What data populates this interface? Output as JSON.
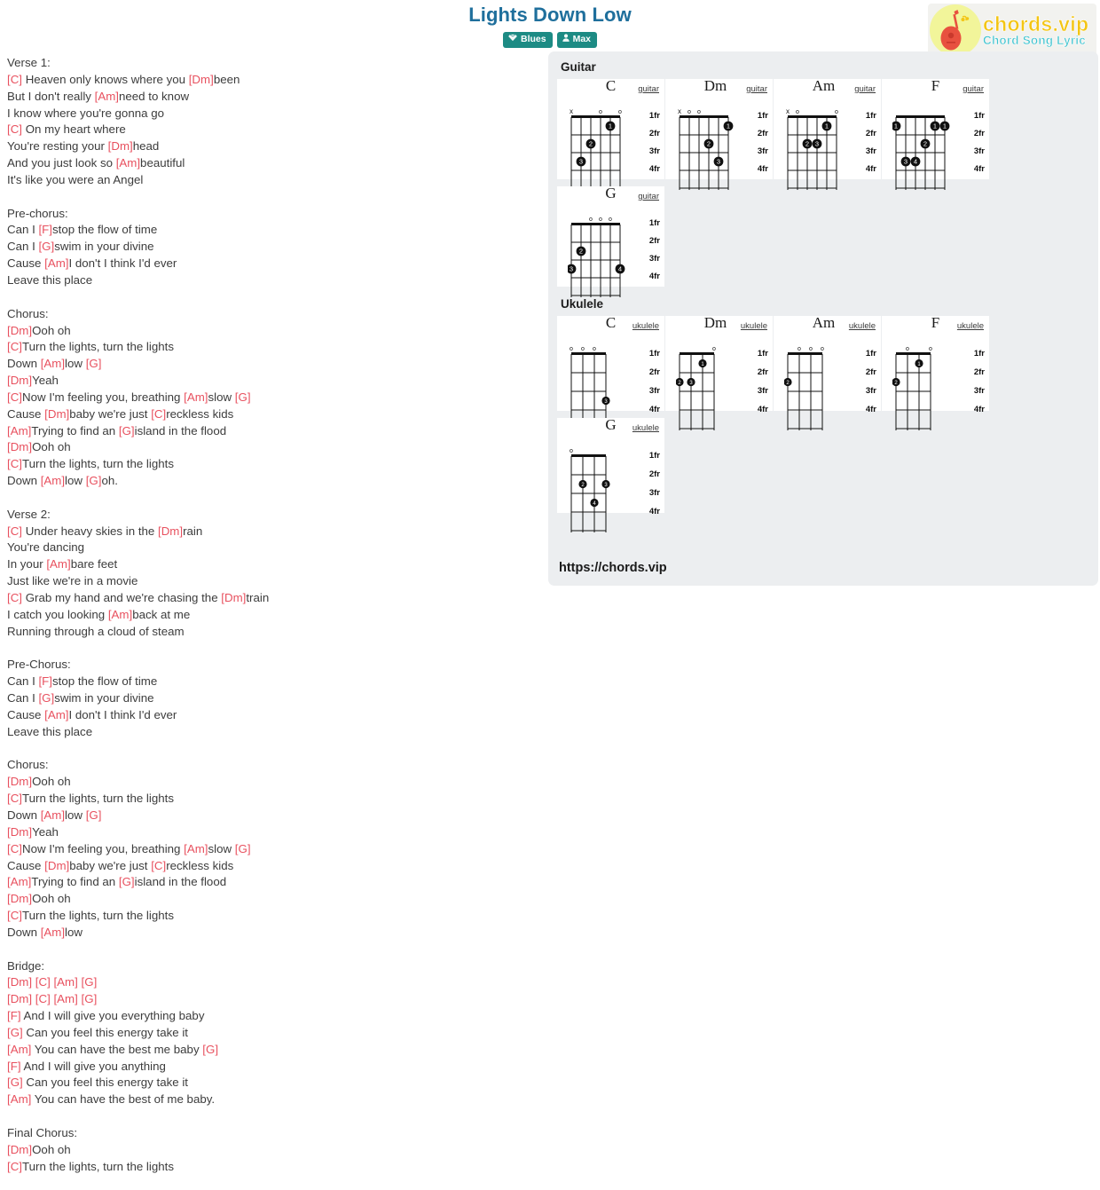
{
  "header": {
    "title": "Lights Down Low",
    "badges": [
      {
        "label": "Blues",
        "icon": "gem-icon",
        "glyph": "♦"
      },
      {
        "label": "Max",
        "icon": "user-icon",
        "glyph": "●"
      }
    ]
  },
  "logo": {
    "line1": "chords.vip",
    "line2": "Chord Song Lyric",
    "icon": "guitar-icon"
  },
  "lyrics": {
    "text": "Verse 1:\n[C] Heaven only knows where you [Dm]been\nBut I don't really [Am]need to know\nI know where you're gonna go\n[C] On my heart where\nYou're resting your [Dm]head\nAnd you just look so [Am]beautiful\nIt's like you were an Angel\n\nPre-chorus:\nCan I [F]stop the flow of time\nCan I [G]swim in your divine\nCause [Am]I don't I think I'd ever\nLeave this place\n\nChorus:\n[Dm]Ooh oh\n[C]Turn the lights, turn the lights\nDown [Am]low [G]\n[Dm]Yeah\n[C]Now I'm feeling you, breathing [Am]slow [G]\nCause [Dm]baby we're just [C]reckless kids\n[Am]Trying to find an [G]island in the flood\n[Dm]Ooh oh\n[C]Turn the lights, turn the lights\nDown [Am]low [G]oh.\n\nVerse 2:\n[C] Under heavy skies in the [Dm]rain\nYou're dancing\nIn your [Am]bare feet\nJust like we're in a movie\n[C] Grab my hand and we're chasing the [Dm]train\nI catch you looking [Am]back at me\nRunning through a cloud of steam\n\nPre-Chorus:\nCan I [F]stop the flow of time\nCan I [G]swim in your divine\nCause [Am]I don't I think I'd ever\nLeave this place\n\nChorus:\n[Dm]Ooh oh\n[C]Turn the lights, turn the lights\nDown [Am]low [G]\n[Dm]Yeah\n[C]Now I'm feeling you, breathing [Am]slow [G]\nCause [Dm]baby we're just [C]reckless kids\n[Am]Trying to find an [G]island in the flood\n[Dm]Ooh oh\n[C]Turn the lights, turn the lights\nDown [Am]low\n\nBridge:\n[Dm] [C] [Am] [G]\n[Dm] [C] [Am] [G]\n[F] And I will give you everything baby\n[G] Can you feel this energy take it\n[Am] You can have the best me baby [G]\n[F] And I will give you anything\n[G] Can you feel this energy take it\n[Am] You can have the best of me baby.\n\nFinal Chorus:\n[Dm]Ooh oh\n[C]Turn the lights, turn the lights"
  },
  "chords": {
    "guitar_section_title": "Guitar",
    "ukulele_section_title": "Ukulele",
    "fret_labels": [
      "1fr",
      "2fr",
      "3fr",
      "4fr"
    ],
    "instrument_label_guitar": "guitar",
    "instrument_label_ukulele": "ukulele",
    "guitar": [
      {
        "name": "C",
        "instrument": "guitar",
        "strings": 6,
        "open_marks": [
          "x",
          "",
          "",
          "o",
          "",
          "o"
        ],
        "dots": [
          {
            "string": 5,
            "fret": 1,
            "finger": "1"
          },
          {
            "string": 3,
            "fret": 2,
            "finger": "2"
          },
          {
            "string": 2,
            "fret": 3,
            "finger": "3"
          }
        ]
      },
      {
        "name": "Dm",
        "instrument": "guitar",
        "strings": 6,
        "open_marks": [
          "x",
          "o",
          "o",
          "",
          "",
          ""
        ],
        "dots": [
          {
            "string": 6,
            "fret": 1,
            "finger": "1"
          },
          {
            "string": 4,
            "fret": 2,
            "finger": "2"
          },
          {
            "string": 5,
            "fret": 3,
            "finger": "3"
          }
        ]
      },
      {
        "name": "Am",
        "instrument": "guitar",
        "strings": 6,
        "open_marks": [
          "x",
          "o",
          "",
          "",
          "",
          "o"
        ],
        "dots": [
          {
            "string": 5,
            "fret": 1,
            "finger": "1"
          },
          {
            "string": 3,
            "fret": 2,
            "finger": "2"
          },
          {
            "string": 4,
            "fret": 2,
            "finger": "3"
          }
        ]
      },
      {
        "name": "F",
        "instrument": "guitar",
        "strings": 6,
        "open_marks": [
          "",
          "",
          "",
          "",
          "",
          ""
        ],
        "dots": [
          {
            "string": 1,
            "fret": 1,
            "finger": "1"
          },
          {
            "string": 5,
            "fret": 1,
            "finger": "1"
          },
          {
            "string": 6,
            "fret": 1,
            "finger": "1"
          },
          {
            "string": 4,
            "fret": 2,
            "finger": "2"
          },
          {
            "string": 2,
            "fret": 3,
            "finger": "3"
          },
          {
            "string": 3,
            "fret": 3,
            "finger": "4"
          }
        ]
      },
      {
        "name": "G",
        "instrument": "guitar",
        "strings": 6,
        "open_marks": [
          "",
          "",
          "o",
          "o",
          "o",
          ""
        ],
        "dots": [
          {
            "string": 2,
            "fret": 2,
            "finger": "2"
          },
          {
            "string": 1,
            "fret": 3,
            "finger": "3"
          },
          {
            "string": 6,
            "fret": 3,
            "finger": "4"
          }
        ]
      }
    ],
    "ukulele": [
      {
        "name": "C",
        "instrument": "ukulele",
        "strings": 4,
        "open_marks": [
          "o",
          "o",
          "o",
          ""
        ],
        "dots": [
          {
            "string": 4,
            "fret": 3,
            "finger": "3"
          }
        ]
      },
      {
        "name": "Dm",
        "instrument": "ukulele",
        "strings": 4,
        "open_marks": [
          "",
          "",
          "",
          "o"
        ],
        "dots": [
          {
            "string": 3,
            "fret": 1,
            "finger": "1"
          },
          {
            "string": 1,
            "fret": 2,
            "finger": "2"
          },
          {
            "string": 2,
            "fret": 2,
            "finger": "3"
          }
        ]
      },
      {
        "name": "Am",
        "instrument": "ukulele",
        "strings": 4,
        "open_marks": [
          "",
          "o",
          "o",
          "o"
        ],
        "dots": [
          {
            "string": 1,
            "fret": 2,
            "finger": "2"
          }
        ]
      },
      {
        "name": "F",
        "instrument": "ukulele",
        "strings": 4,
        "open_marks": [
          "",
          "o",
          "",
          "o"
        ],
        "dots": [
          {
            "string": 3,
            "fret": 1,
            "finger": "1"
          },
          {
            "string": 1,
            "fret": 2,
            "finger": "2"
          }
        ]
      },
      {
        "name": "G",
        "instrument": "ukulele",
        "strings": 4,
        "open_marks": [
          "o",
          "",
          "",
          ""
        ],
        "dots": [
          {
            "string": 2,
            "fret": 2,
            "finger": "2"
          },
          {
            "string": 4,
            "fret": 2,
            "finger": "3"
          },
          {
            "string": 3,
            "fret": 3,
            "finger": "4"
          }
        ]
      }
    ],
    "site_url": "https://chords.vip"
  },
  "colors": {
    "title": "#1f6f9c",
    "badge": "#1d8b84",
    "chord_text": "#e8515f",
    "panel_bg": "#eceef0",
    "logo_yellow": "#f3c514",
    "logo_cyan": "#3fc3cf"
  }
}
